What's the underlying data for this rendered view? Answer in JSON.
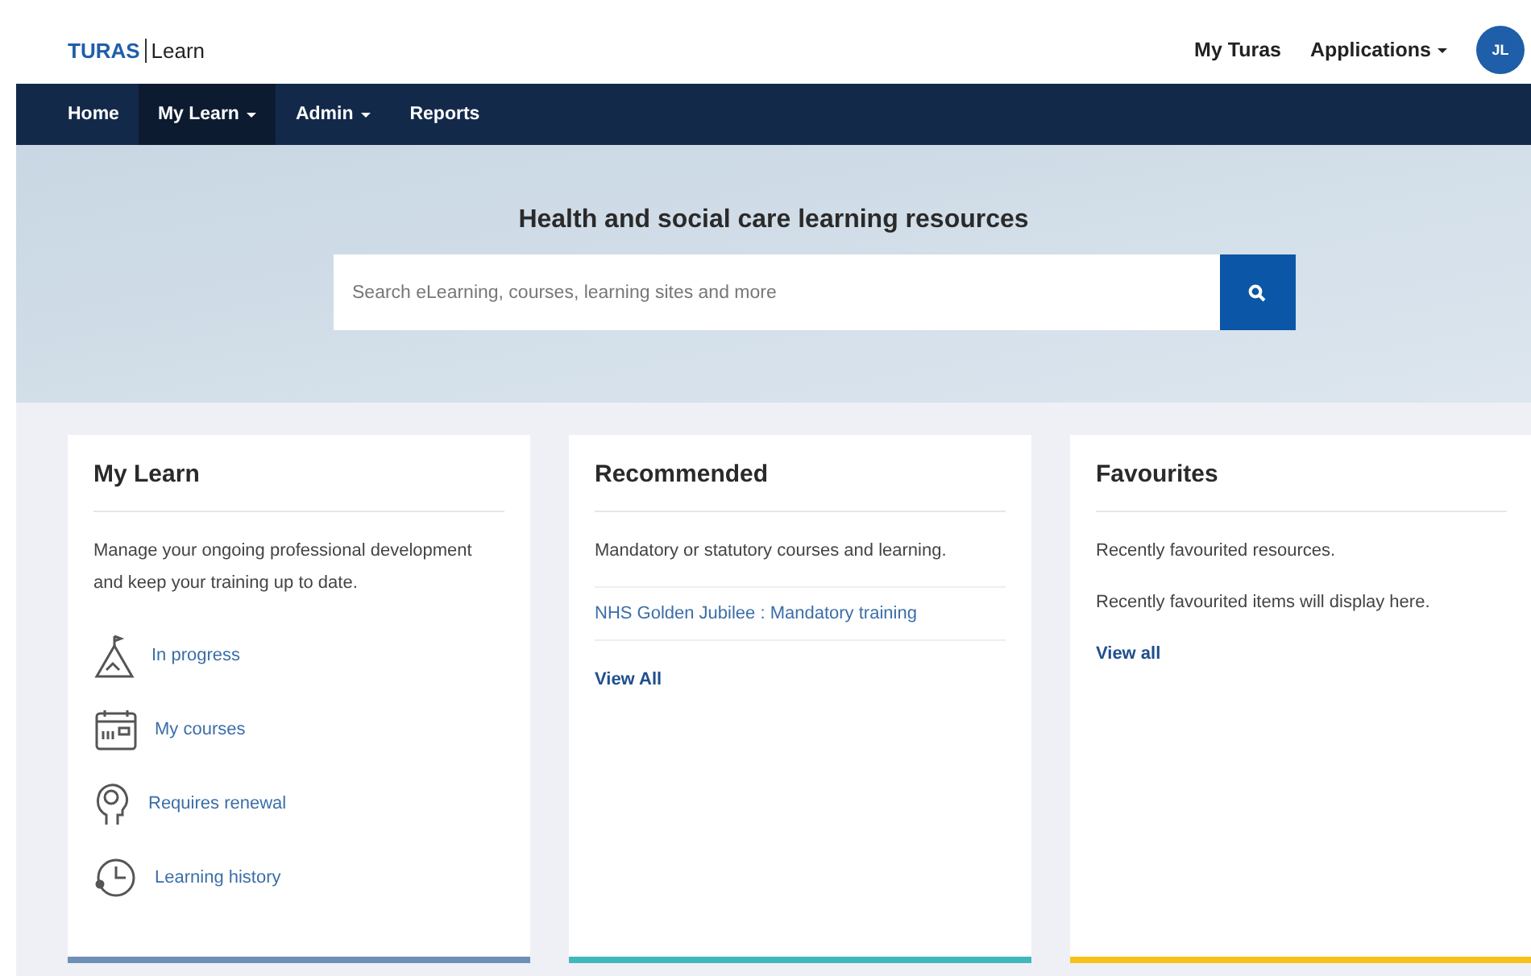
{
  "header": {
    "brand": "TURAS",
    "product": "Learn",
    "links": [
      {
        "label": "My Turas",
        "dropdown": false
      },
      {
        "label": "Applications",
        "dropdown": true
      }
    ],
    "avatar": "JL"
  },
  "nav": [
    {
      "label": "Home",
      "dropdown": false,
      "selected": false
    },
    {
      "label": "My Learn",
      "dropdown": true,
      "selected": true
    },
    {
      "label": "Admin",
      "dropdown": true,
      "selected": false
    },
    {
      "label": "Reports",
      "dropdown": false,
      "selected": false
    }
  ],
  "hero": {
    "title": "Health and social care learning resources",
    "search": {
      "placeholder": "Search eLearning, courses, learning sites and more"
    }
  },
  "cards": [
    {
      "title": "My Learn",
      "color": "#6f8fb8",
      "texts": [
        "Manage your ongoing professional development and keep your training up to date."
      ],
      "links": [
        {
          "label": "In progress"
        },
        {
          "label": "My courses"
        },
        {
          "label": "Requires renewal"
        },
        {
          "label": "Learning history"
        }
      ]
    },
    {
      "title": "Recommended",
      "color": "#3fb8bb",
      "texts": [
        "Mandatory or statutory courses and learning."
      ],
      "list": [
        "NHS Golden Jubilee : Mandatory training"
      ],
      "view_all": "View All"
    },
    {
      "title": "Favourites",
      "color": "#f8c11a",
      "texts": [
        "Recently favourited resources.",
        "Recently favourited items will display here."
      ],
      "view_all": "View all"
    }
  ]
}
